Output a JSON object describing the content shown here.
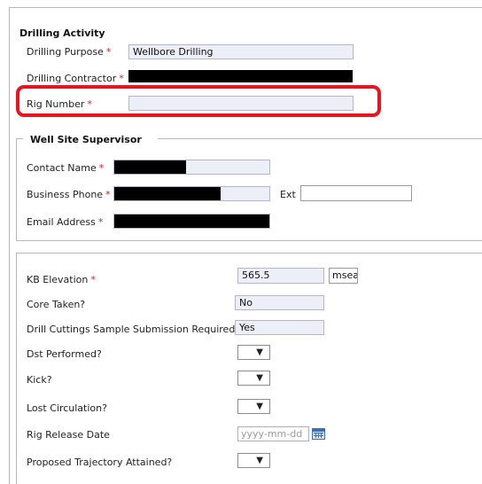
{
  "drilling_activity": {
    "title": "Drilling Activity",
    "purpose_label": "Drilling Purpose",
    "purpose_value": "Wellbore Drilling",
    "contractor_label": "Drilling Contractor",
    "rig_number_label": "Rig Number",
    "rig_number_value": ""
  },
  "well_site_supervisor": {
    "title": "Well Site Supervisor",
    "contact_name_label": "Contact Name",
    "business_phone_label": "Business Phone",
    "ext_label": "Ext",
    "ext_value": "",
    "email_label": "Email Address"
  },
  "details": {
    "kb_elevation_label": "KB Elevation",
    "kb_elevation_value": "565.5",
    "kb_elevation_unit": "msea",
    "core_taken_label": "Core Taken?",
    "core_taken_value": "No",
    "cuttings_label": "Drill Cuttings Sample Submission Required?",
    "cuttings_value": "Yes",
    "dst_label": "Dst Performed?",
    "kick_label": "Kick?",
    "lost_circulation_label": "Lost Circulation?",
    "rig_release_label": "Rig Release Date",
    "rig_release_placeholder": "yyyy-mm-dd",
    "trajectory_label": "Proposed Trajectory Attained?"
  },
  "required_marker": "*",
  "dropdown_chevron": "▼",
  "colors": {
    "required": "#e02020",
    "highlight": "#e8141f",
    "field_bg": "#eceef8"
  },
  "icons": {
    "calendar": "calendar-icon",
    "dropdown": "chevron-down-icon"
  }
}
